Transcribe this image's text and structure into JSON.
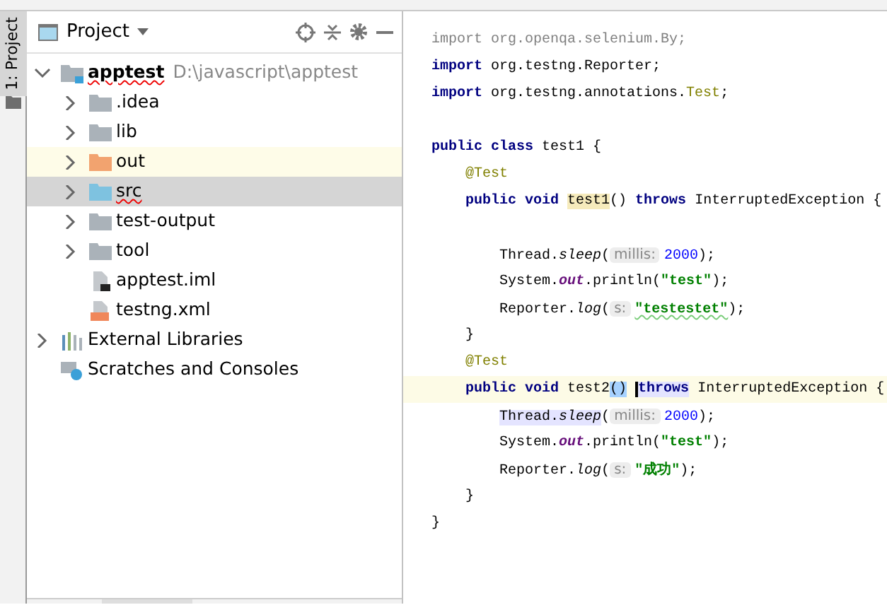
{
  "tool_window_tab": {
    "label": "1: Project"
  },
  "project_panel": {
    "title": "Project",
    "tree": [
      {
        "label": "apptest",
        "path": "D:\\javascript\\apptest",
        "kind": "module",
        "expanded": true,
        "selected": false,
        "highlighted": false,
        "underlined": true,
        "children": [
          {
            "label": ".idea",
            "kind": "folder",
            "expanded": false,
            "selected": false,
            "highlighted": false,
            "underlined": false
          },
          {
            "label": "lib",
            "kind": "folder",
            "expanded": false,
            "selected": false,
            "highlighted": false,
            "underlined": false
          },
          {
            "label": "out",
            "kind": "excluded",
            "expanded": false,
            "selected": false,
            "highlighted": true,
            "underlined": false
          },
          {
            "label": "src",
            "kind": "source",
            "expanded": false,
            "selected": true,
            "highlighted": false,
            "underlined": true
          },
          {
            "label": "test-output",
            "kind": "folder",
            "expanded": false,
            "selected": false,
            "highlighted": false,
            "underlined": false
          },
          {
            "label": "tool",
            "kind": "folder",
            "expanded": false,
            "selected": false,
            "highlighted": false,
            "underlined": false
          },
          {
            "label": "apptest.iml",
            "kind": "iml",
            "selected": false,
            "highlighted": false,
            "underlined": false
          },
          {
            "label": "testng.xml",
            "kind": "xml",
            "selected": false,
            "highlighted": false,
            "underlined": false
          }
        ]
      },
      {
        "label": "External Libraries",
        "kind": "libraries",
        "expanded": false,
        "selected": false,
        "highlighted": false,
        "underlined": false
      },
      {
        "label": "Scratches and Consoles",
        "kind": "scratches",
        "selected": false,
        "highlighted": false,
        "underlined": false
      }
    ]
  },
  "editor": {
    "lines": [
      {
        "current": false,
        "tokens": [
          {
            "kind": "unused",
            "text": "import org.openqa.selenium.By;"
          }
        ]
      },
      {
        "current": false,
        "tokens": [
          {
            "kind": "kw",
            "text": "import"
          },
          {
            "kind": "plain",
            "text": " org.testng.Reporter;"
          }
        ]
      },
      {
        "current": false,
        "tokens": [
          {
            "kind": "kw",
            "text": "import"
          },
          {
            "kind": "plain",
            "text": " org.testng.annotations."
          },
          {
            "kind": "ann",
            "text": "Test"
          },
          {
            "kind": "plain",
            "text": ";"
          }
        ]
      },
      {
        "current": false
      },
      {
        "current": false,
        "tokens": [
          {
            "kind": "kw",
            "text": "public class"
          },
          {
            "kind": "plain",
            "text": " test1 {"
          }
        ]
      },
      {
        "current": false,
        "tokens": [
          {
            "kind": "ann",
            "text": "    @Test"
          }
        ]
      },
      {
        "current": false,
        "tokens": [
          {
            "kind": "kw",
            "text": "    public void "
          },
          {
            "kind": "plain",
            "text": "test1",
            "usage": true
          },
          {
            "kind": "plain",
            "text": "() "
          },
          {
            "kind": "kw",
            "text": "throws"
          },
          {
            "kind": "plain",
            "text": " InterruptedException {"
          }
        ]
      },
      {
        "current": false
      },
      {
        "current": false,
        "tokens": [
          {
            "kind": "plain",
            "text": "        Thread."
          },
          {
            "kind": "static",
            "text": "sleep"
          },
          {
            "kind": "plain",
            "text": "("
          },
          {
            "kind": "hint",
            "text": "millis:"
          },
          {
            "kind": "num",
            "text": "2000"
          },
          {
            "kind": "plain",
            "text": ");"
          }
        ]
      },
      {
        "current": false,
        "tokens": [
          {
            "kind": "plain",
            "text": "        System."
          },
          {
            "kind": "field",
            "text": "out"
          },
          {
            "kind": "plain",
            "text": ".println("
          },
          {
            "kind": "str",
            "text": "\"test\""
          },
          {
            "kind": "plain",
            "text": ");"
          }
        ]
      },
      {
        "current": false,
        "tokens": [
          {
            "kind": "plain",
            "text": "        Reporter."
          },
          {
            "kind": "static",
            "text": "log"
          },
          {
            "kind": "plain",
            "text": "("
          },
          {
            "kind": "hint",
            "text": "s:"
          },
          {
            "kind": "str",
            "text": "\"testestet\"",
            "typo": true
          },
          {
            "kind": "plain",
            "text": ");"
          }
        ]
      },
      {
        "current": false,
        "tokens": [
          {
            "kind": "plain",
            "text": "    }"
          }
        ]
      },
      {
        "current": false,
        "tokens": [
          {
            "kind": "ann",
            "text": "    @Test"
          }
        ]
      },
      {
        "current": true,
        "tokens": [
          {
            "kind": "kw",
            "text": "    public void "
          },
          {
            "kind": "plain",
            "text": "test2"
          },
          {
            "kind": "plain",
            "text": "()",
            "selected": true
          },
          {
            "kind": "kw",
            "text": "throws",
            "exit_point": true,
            "caret": true
          },
          {
            "kind": "plain",
            "text": " InterruptedException {"
          }
        ]
      },
      {
        "current": false,
        "tokens": [
          {
            "kind": "plain",
            "text": "        Thread.",
            "exit_point": true
          },
          {
            "kind": "static",
            "text": "sleep",
            "exit_point": true
          },
          {
            "kind": "plain",
            "text": "("
          },
          {
            "kind": "hint",
            "text": "millis:"
          },
          {
            "kind": "num",
            "text": "2000"
          },
          {
            "kind": "plain",
            "text": ");"
          }
        ]
      },
      {
        "current": false,
        "tokens": [
          {
            "kind": "plain",
            "text": "        System."
          },
          {
            "kind": "field",
            "text": "out"
          },
          {
            "kind": "plain",
            "text": ".println("
          },
          {
            "kind": "str",
            "text": "\"test\""
          },
          {
            "kind": "plain",
            "text": ");"
          }
        ]
      },
      {
        "current": false,
        "tokens": [
          {
            "kind": "plain",
            "text": "        Reporter."
          },
          {
            "kind": "static",
            "text": "log"
          },
          {
            "kind": "plain",
            "text": "("
          },
          {
            "kind": "hint",
            "text": "s:"
          },
          {
            "kind": "str",
            "text": "\"成功\""
          },
          {
            "kind": "plain",
            "text": ");"
          }
        ]
      },
      {
        "current": false,
        "tokens": [
          {
            "kind": "plain",
            "text": "    }"
          }
        ]
      },
      {
        "current": false,
        "tokens": [
          {
            "kind": "plain",
            "text": "}"
          }
        ]
      }
    ]
  }
}
